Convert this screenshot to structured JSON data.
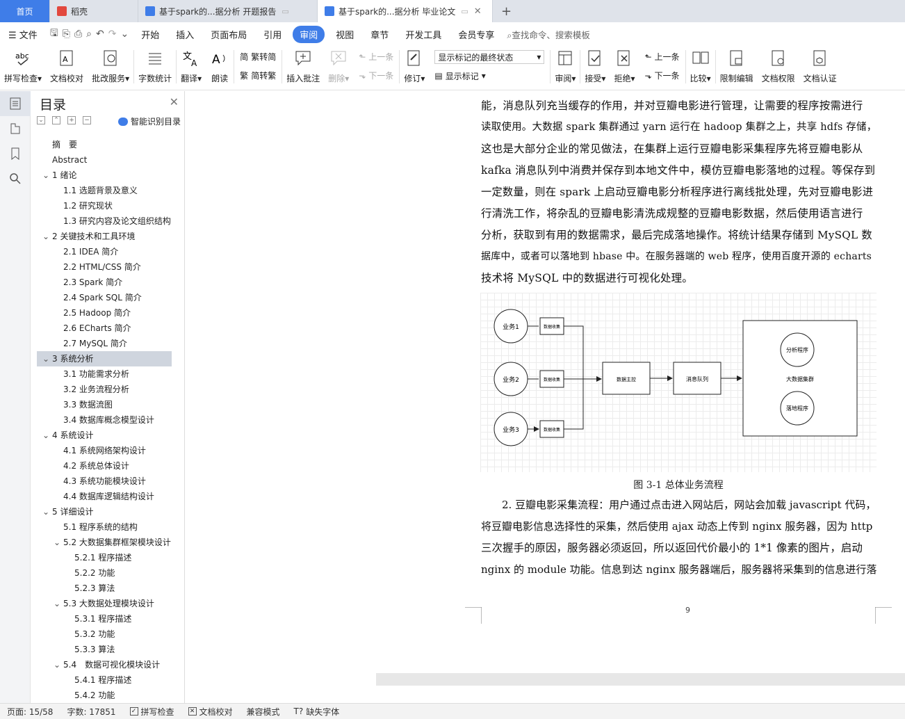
{
  "tabs": [
    {
      "label": "首页"
    },
    {
      "label": "稻壳"
    },
    {
      "label": "基于spark的...据分析 开题报告"
    },
    {
      "label": "基于spark的...据分析 毕业论文"
    }
  ],
  "menu": {
    "file": "文件",
    "items": [
      "开始",
      "插入",
      "页面布局",
      "引用",
      "审阅",
      "视图",
      "章节",
      "开发工具",
      "会员专享"
    ],
    "search": "查找命令、搜索模板"
  },
  "ribbon": {
    "spell": "拼写检查",
    "proof": "文档校对",
    "batch": "批改服务",
    "wordcount": "字数统计",
    "translate": "翻译",
    "read": "朗读",
    "trad": "繁转简",
    "simp": "简转繁",
    "insert_comment": "插入批注",
    "delete": "删除",
    "prev_comment": "上一条",
    "next_comment": "下一条",
    "revise": "修订",
    "markup_state": "显示标记的最终状态",
    "show_markup": "显示标记",
    "review": "审阅",
    "accept": "接受",
    "reject": "拒绝",
    "prev": "上一条",
    "next": "下一条",
    "compare": "比较",
    "restrict": "限制编辑",
    "permission": "文档权限",
    "certify": "文档认证"
  },
  "toc": {
    "title": "目录",
    "smart": "智能识别目录",
    "items": [
      {
        "text": "摘　要",
        "indent": 0,
        "arrow": ""
      },
      {
        "text": "Abstract",
        "indent": 0,
        "arrow": ""
      },
      {
        "text": "1  绪论",
        "indent": 0,
        "arrow": "v"
      },
      {
        "text": "1.1  选题背景及意义",
        "indent": 1,
        "arrow": ""
      },
      {
        "text": "1.2  研究现状",
        "indent": 1,
        "arrow": ""
      },
      {
        "text": "1.3  研究内容及论文组织结构",
        "indent": 1,
        "arrow": ""
      },
      {
        "text": "2  关键技术和工具环境",
        "indent": 0,
        "arrow": "v"
      },
      {
        "text": "2.1 IDEA 简介",
        "indent": 1,
        "arrow": ""
      },
      {
        "text": "2.2 HTML/CSS 简介",
        "indent": 1,
        "arrow": ""
      },
      {
        "text": "2.3 Spark 简介",
        "indent": 1,
        "arrow": ""
      },
      {
        "text": "2.4 Spark SQL 简介",
        "indent": 1,
        "arrow": ""
      },
      {
        "text": "2.5 Hadoop 简介",
        "indent": 1,
        "arrow": ""
      },
      {
        "text": "2.6 ECharts 简介",
        "indent": 1,
        "arrow": ""
      },
      {
        "text": "2.7 MySQL 简介",
        "indent": 1,
        "arrow": ""
      },
      {
        "text": "3  系统分析",
        "indent": 0,
        "arrow": "v",
        "selected": true
      },
      {
        "text": "3.1  功能需求分析",
        "indent": 1,
        "arrow": ""
      },
      {
        "text": "3.2  业务流程分析",
        "indent": 1,
        "arrow": ""
      },
      {
        "text": "3.3  数据流图",
        "indent": 1,
        "arrow": ""
      },
      {
        "text": "3.4  数据库概念模型设计",
        "indent": 1,
        "arrow": ""
      },
      {
        "text": "4  系统设计",
        "indent": 0,
        "arrow": "v"
      },
      {
        "text": "4.1  系统网络架构设计",
        "indent": 1,
        "arrow": ""
      },
      {
        "text": "4.2  系统总体设计",
        "indent": 1,
        "arrow": ""
      },
      {
        "text": "4.3  系统功能模块设计",
        "indent": 1,
        "arrow": ""
      },
      {
        "text": "4.4  数据库逻辑结构设计",
        "indent": 1,
        "arrow": ""
      },
      {
        "text": "5  详细设计",
        "indent": 0,
        "arrow": "v"
      },
      {
        "text": "5.1  程序系统的结构",
        "indent": 1,
        "arrow": ""
      },
      {
        "text": "5.2  大数据集群框架模块设计",
        "indent": 1,
        "arrow": "v"
      },
      {
        "text": "5.2.1  程序描述",
        "indent": 2,
        "arrow": ""
      },
      {
        "text": "5.2.2  功能",
        "indent": 2,
        "arrow": ""
      },
      {
        "text": "5.2.3  算法",
        "indent": 2,
        "arrow": ""
      },
      {
        "text": "5.3  大数据处理模块设计",
        "indent": 1,
        "arrow": "v"
      },
      {
        "text": "5.3.1  程序描述",
        "indent": 2,
        "arrow": ""
      },
      {
        "text": "5.3.2  功能",
        "indent": 2,
        "arrow": ""
      },
      {
        "text": "5.3.3  算法",
        "indent": 2,
        "arrow": ""
      },
      {
        "text": "5.4　数据可视化模块设计",
        "indent": 1,
        "arrow": "v"
      },
      {
        "text": "5.4.1  程序描述",
        "indent": 2,
        "arrow": ""
      },
      {
        "text": "5.4.2  功能",
        "indent": 2,
        "arrow": ""
      }
    ]
  },
  "document": {
    "para1_lines": [
      "能，消息队列充当缓存的作用，并对豆瓣电影进行管理，让需要的程序按需进行",
      "读取使用。大数据 spark 集群通过 yarn 运行在 hadoop 集群之上，共享 hdfs 存储，",
      "这也是大部分企业的常见做法，在集群上运行豆瓣电影采集程序先将豆瓣电影从",
      "kafka 消息队列中消费并保存到本地文件中，模仿豆瓣电影落地的过程。等保存到",
      "一定数量，则在 spark 上启动豆瓣电影分析程序进行离线批处理，先对豆瓣电影进",
      "行清洗工作，将杂乱的豆瓣电影清洗成规整的豆瓣电影数据，然后使用语言进行",
      "分析，获取到有用的数据需求，最后完成落地操作。将统计结果存储到 MySQL 数",
      "据库中，或者可以落地到 hbase 中。在服务器端的 web 程序，使用百度开源的 echarts",
      "技术将 MySQL 中的数据进行可视化处理。"
    ],
    "figure": {
      "biz1": "业务1",
      "biz2": "业务2",
      "biz3": "业务3",
      "collect": "数据收集",
      "hub": "数据主控",
      "queue": "消息队列",
      "cluster": "大数据集群",
      "analysis": "分析程序",
      "landing": "落地程序"
    },
    "caption": "图 3-1 总体业务流程",
    "para2_lines": [
      "　　2. 豆瓣电影采集流程：用户通过点击进入网站后，网站会加载 javascript 代码，",
      "将豆瓣电影信息选择性的采集，然后使用 ajax 动态上传到 nginx 服务器，因为 http",
      "三次握手的原因，服务器必须返回，所以返回代价最小的 1*1 像素的图片，启动",
      "nginx 的 module 功能。信息到达 nginx 服务器端后，服务器将采集到的信息进行落"
    ],
    "page_number": "9"
  },
  "status": {
    "page": "页面: 15/58",
    "words": "字数: 17851",
    "spell": "拼写检查",
    "proof": "文档校对",
    "compat": "兼容模式",
    "missing_font": "缺失字体"
  },
  "colors": {
    "accent": "#3f7de8",
    "docer": "#e2483d",
    "word": "#3f7de8"
  }
}
